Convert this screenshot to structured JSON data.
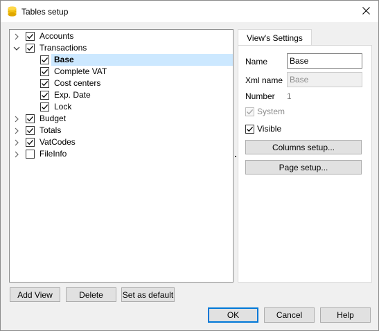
{
  "window": {
    "title": "Tables setup",
    "app_icon": "banana-cylinder-icon",
    "close_icon": "close-icon"
  },
  "tree": {
    "nodes": [
      {
        "label": "Accounts",
        "checked": true,
        "expandable": true,
        "expanded": false,
        "level": 0
      },
      {
        "label": "Transactions",
        "checked": true,
        "expandable": true,
        "expanded": true,
        "level": 0
      },
      {
        "label": "Base",
        "checked": true,
        "expandable": false,
        "level": 1,
        "selected": true
      },
      {
        "label": "Complete VAT",
        "checked": true,
        "expandable": false,
        "level": 1
      },
      {
        "label": "Cost centers",
        "checked": true,
        "expandable": false,
        "level": 1
      },
      {
        "label": "Exp. Date",
        "checked": true,
        "expandable": false,
        "level": 1
      },
      {
        "label": "Lock",
        "checked": true,
        "expandable": false,
        "level": 1
      },
      {
        "label": "Budget",
        "checked": true,
        "expandable": true,
        "expanded": false,
        "level": 0
      },
      {
        "label": "Totals",
        "checked": true,
        "expandable": true,
        "expanded": false,
        "level": 0
      },
      {
        "label": "VatCodes",
        "checked": true,
        "expandable": true,
        "expanded": false,
        "level": 0
      },
      {
        "label": "FileInfo",
        "checked": false,
        "expandable": true,
        "expanded": false,
        "level": 0
      }
    ]
  },
  "settings": {
    "tab_label": "View's Settings",
    "name_label": "Name",
    "name_value": "Base",
    "xml_name_label": "Xml name",
    "xml_name_value": "Base",
    "number_label": "Number",
    "number_value": "1",
    "system_label": "System",
    "system_checked": true,
    "visible_label": "Visible",
    "visible_checked": true,
    "columns_setup_label": "Columns setup...",
    "page_setup_label": "Page setup..."
  },
  "view_buttons": {
    "add_view": "Add View",
    "delete": "Delete",
    "set_default": "Set as default"
  },
  "dialog_buttons": {
    "ok": "OK",
    "cancel": "Cancel",
    "help": "Help"
  },
  "colors": {
    "selection": "#cce8ff",
    "default_button_border": "#0078d7",
    "app_icon": "#f5c518"
  }
}
